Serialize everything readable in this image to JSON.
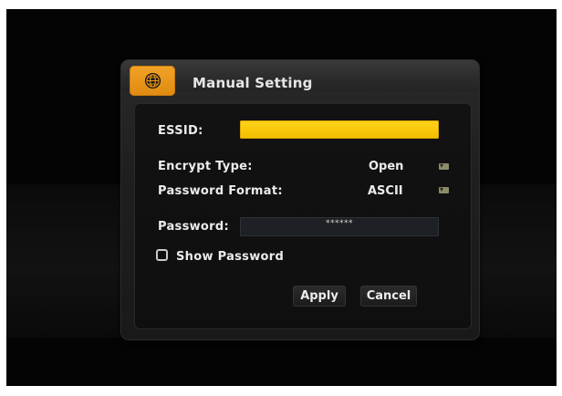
{
  "dialog": {
    "title": "Manual Setting",
    "title_icon": "globe-icon",
    "accent_color": "#f2a229",
    "highlight_color": "#ffd21a"
  },
  "form": {
    "essid_label": "ESSID:",
    "essid_value": "",
    "encrypt_type_label": "Encrypt Type:",
    "encrypt_type_value": "Open",
    "password_format_label": "Password Format:",
    "password_format_value": "ASCII",
    "password_label": "Password:",
    "password_mask": "******",
    "show_password_label": "Show Password",
    "show_password_checked": false
  },
  "buttons": {
    "apply_label": "Apply",
    "cancel_label": "Cancel"
  }
}
